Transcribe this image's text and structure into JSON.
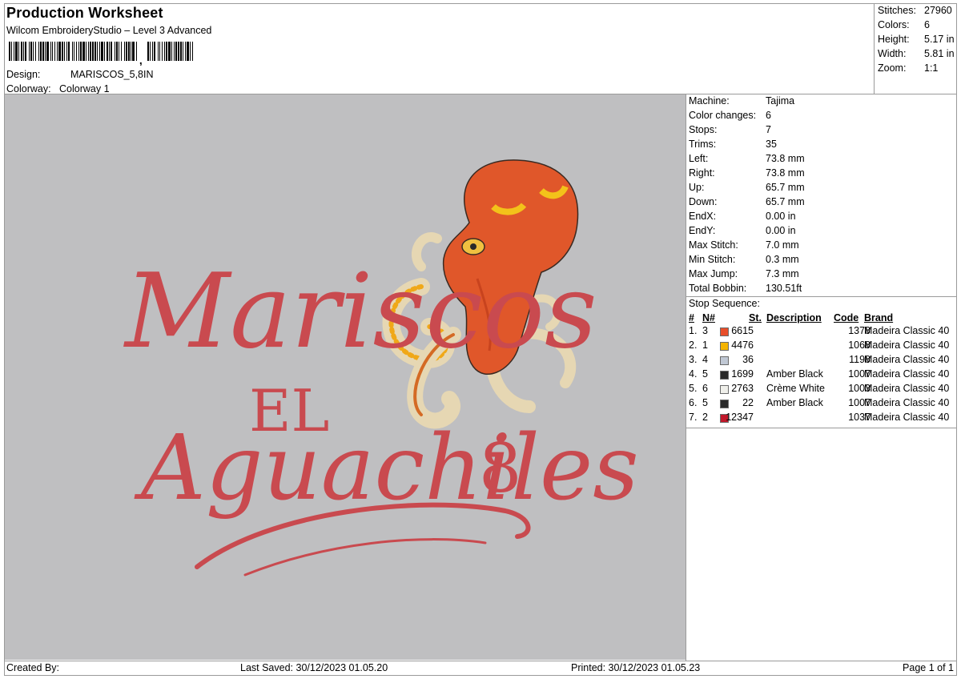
{
  "header": {
    "title": "Production Worksheet",
    "subtitle": "Wilcom EmbroideryStudio – Level 3 Advanced",
    "design_label": "Design:",
    "design_value": "MARISCOS_5,8IN",
    "colorway_label": "Colorway:",
    "colorway_value": "Colorway 1"
  },
  "summary": {
    "rows": [
      {
        "label": "Stitches:",
        "value": "27960"
      },
      {
        "label": "Colors:",
        "value": "6"
      },
      {
        "label": "Height:",
        "value": "5.17 in"
      },
      {
        "label": "Width:",
        "value": "5.81 in"
      },
      {
        "label": "Zoom:",
        "value": "1:1"
      }
    ]
  },
  "preview": {
    "line1": "Mariscos",
    "line2": "EL",
    "line3": "Aguachiles",
    "numeral": "8",
    "background": "#bfbfc1",
    "text_color": "#c94a4f",
    "octopus_color": "#e0572a"
  },
  "machine": {
    "rows": [
      {
        "label": "Machine:",
        "value": "Tajima"
      },
      {
        "label": "Color changes:",
        "value": "6"
      },
      {
        "label": "Stops:",
        "value": "7"
      },
      {
        "label": "Trims:",
        "value": "35"
      },
      {
        "label": "Left:",
        "value": "73.8 mm"
      },
      {
        "label": "Right:",
        "value": "73.8 mm"
      },
      {
        "label": "Up:",
        "value": "65.7 mm"
      },
      {
        "label": "Down:",
        "value": "65.7 mm"
      },
      {
        "label": "EndX:",
        "value": "0.00 in"
      },
      {
        "label": "EndY:",
        "value": "0.00 in"
      },
      {
        "label": "Max Stitch:",
        "value": "7.0 mm"
      },
      {
        "label": "Min Stitch:",
        "value": "0.3 mm"
      },
      {
        "label": "Max Jump:",
        "value": "7.3 mm"
      },
      {
        "label": "Total Bobbin:",
        "value": "130.51ft"
      }
    ]
  },
  "stop_sequence": {
    "heading": "Stop Sequence:",
    "columns": {
      "idx": "#",
      "n": "N#",
      "st": "St.",
      "desc": "Description",
      "code": "Code",
      "brand": "Brand"
    },
    "rows": [
      {
        "idx": "1.",
        "n": "3",
        "color": "#e84e2a",
        "st": "6615",
        "desc": "",
        "code": "1378",
        "brand": "Madeira Classic 40"
      },
      {
        "idx": "2.",
        "n": "1",
        "color": "#f5b400",
        "st": "4476",
        "desc": "",
        "code": "1068",
        "brand": "Madeira Classic 40"
      },
      {
        "idx": "3.",
        "n": "4",
        "color": "#c0c8d4",
        "st": "36",
        "desc": "",
        "code": "1198",
        "brand": "Madeira Classic 40"
      },
      {
        "idx": "4.",
        "n": "5",
        "color": "#2a2a2a",
        "st": "1699",
        "desc": "Amber Black",
        "code": "1007",
        "brand": "Madeira Classic 40"
      },
      {
        "idx": "5.",
        "n": "6",
        "color": "#efefea",
        "st": "2763",
        "desc": "Crème White",
        "code": "1003",
        "brand": "Madeira Classic 40"
      },
      {
        "idx": "6.",
        "n": "5",
        "color": "#2a2a2a",
        "st": "22",
        "desc": "Amber Black",
        "code": "1007",
        "brand": "Madeira Classic 40"
      },
      {
        "idx": "7.",
        "n": "2",
        "color": "#c0182a",
        "st": "12347",
        "desc": "",
        "code": "1037",
        "brand": "Madeira Classic 40"
      }
    ]
  },
  "footer": {
    "created_by": "Created By:",
    "last_saved": "Last Saved: 30/12/2023 01.05.20",
    "printed": "Printed: 30/12/2023 01.05.23",
    "page": "Page 1 of 1"
  }
}
